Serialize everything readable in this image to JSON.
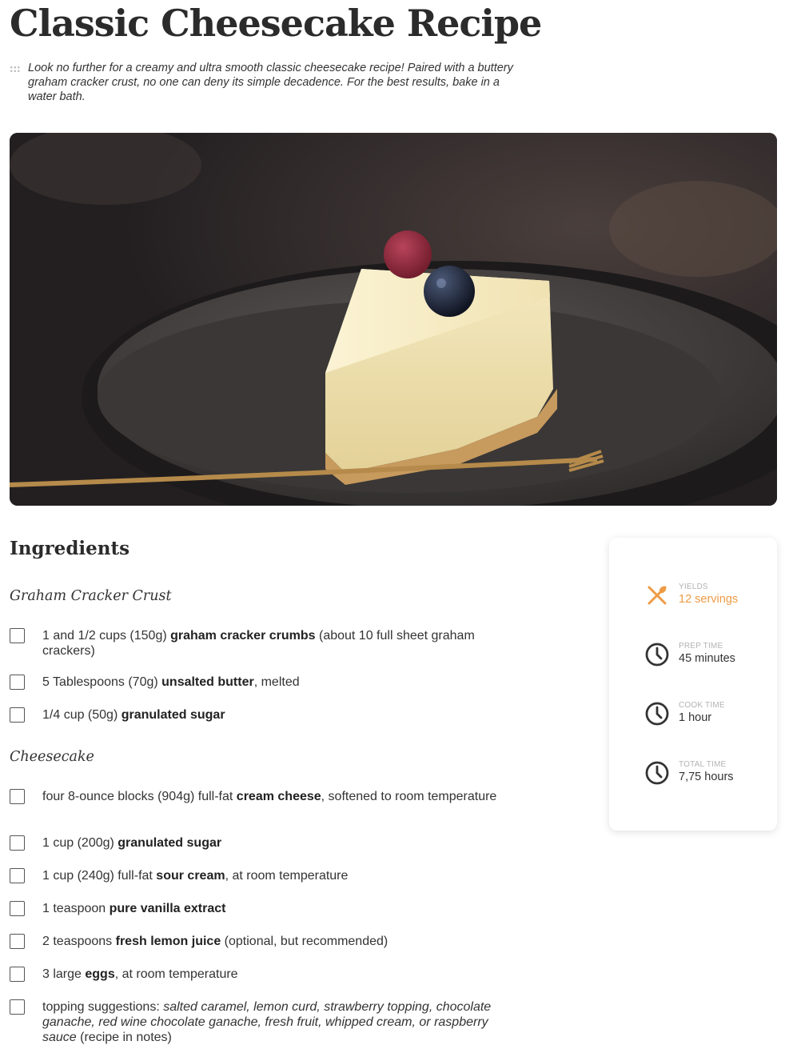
{
  "recipe": {
    "title": "Classic Cheesecake Recipe",
    "description": "Look no further for a creamy and ultra smooth classic cheesecake recipe! Paired with a buttery graham cracker crust, no one can deny its simple decadence. For the best results, bake in a water bath."
  },
  "image": {
    "alt": "Slice of cheesecake topped with a raspberry and blueberry on a dark plate with a gold fork"
  },
  "ingredients": {
    "heading": "Ingredients",
    "groups": [
      {
        "title": "Graham Cracker Crust",
        "items": [
          {
            "pre": "1 and 1/2 cups (150g) ",
            "bold": "graham cracker crumbs",
            "post": " (about 10 full sheet graham crackers)"
          },
          {
            "pre": "5 Tablespoons (70g) ",
            "bold": "unsalted butter",
            "post": ", melted"
          },
          {
            "pre": "1/4 cup (50g) ",
            "bold": "granulated sugar",
            "post": ""
          }
        ]
      },
      {
        "title": "Cheesecake",
        "items": [
          {
            "pre": "four 8-ounce blocks (904g) full-fat ",
            "bold": "cream cheese",
            "post": ", softened to room temperature"
          },
          {
            "pre": "1 cup (200g) ",
            "bold": "granulated sugar",
            "post": ""
          },
          {
            "pre": "1 cup (240g) full-fat ",
            "bold": "sour cream",
            "post": ", at room temperature"
          },
          {
            "pre": "1 teaspoon ",
            "bold": "pure vanilla extract",
            "post": ""
          },
          {
            "pre": "2 teaspoons ",
            "bold": "fresh lemon juice",
            "post": " (optional, but recommended)"
          },
          {
            "pre": "3 large ",
            "bold": "eggs",
            "post": ", at room temperature"
          },
          {
            "pre": "topping suggestions: ",
            "italic": "salted caramel, lemon curd, strawberry topping, chocolate ganache, red wine chocolate ganache, fresh fruit, whipped cream, or raspberry sauce",
            "post": " (recipe in notes)"
          }
        ]
      }
    ]
  },
  "meta": {
    "accent_color": "#ee9b45",
    "items": [
      {
        "icon": "utensils-icon",
        "label": "YIELDS",
        "value": "12 servings"
      },
      {
        "icon": "clock-icon",
        "label": "PREP TIME",
        "value": "45 minutes"
      },
      {
        "icon": "clock-icon",
        "label": "COOK TIME",
        "value": "1 hour"
      },
      {
        "icon": "clock-icon",
        "label": "TOTAL TIME",
        "value": "7,75 hours"
      }
    ]
  }
}
